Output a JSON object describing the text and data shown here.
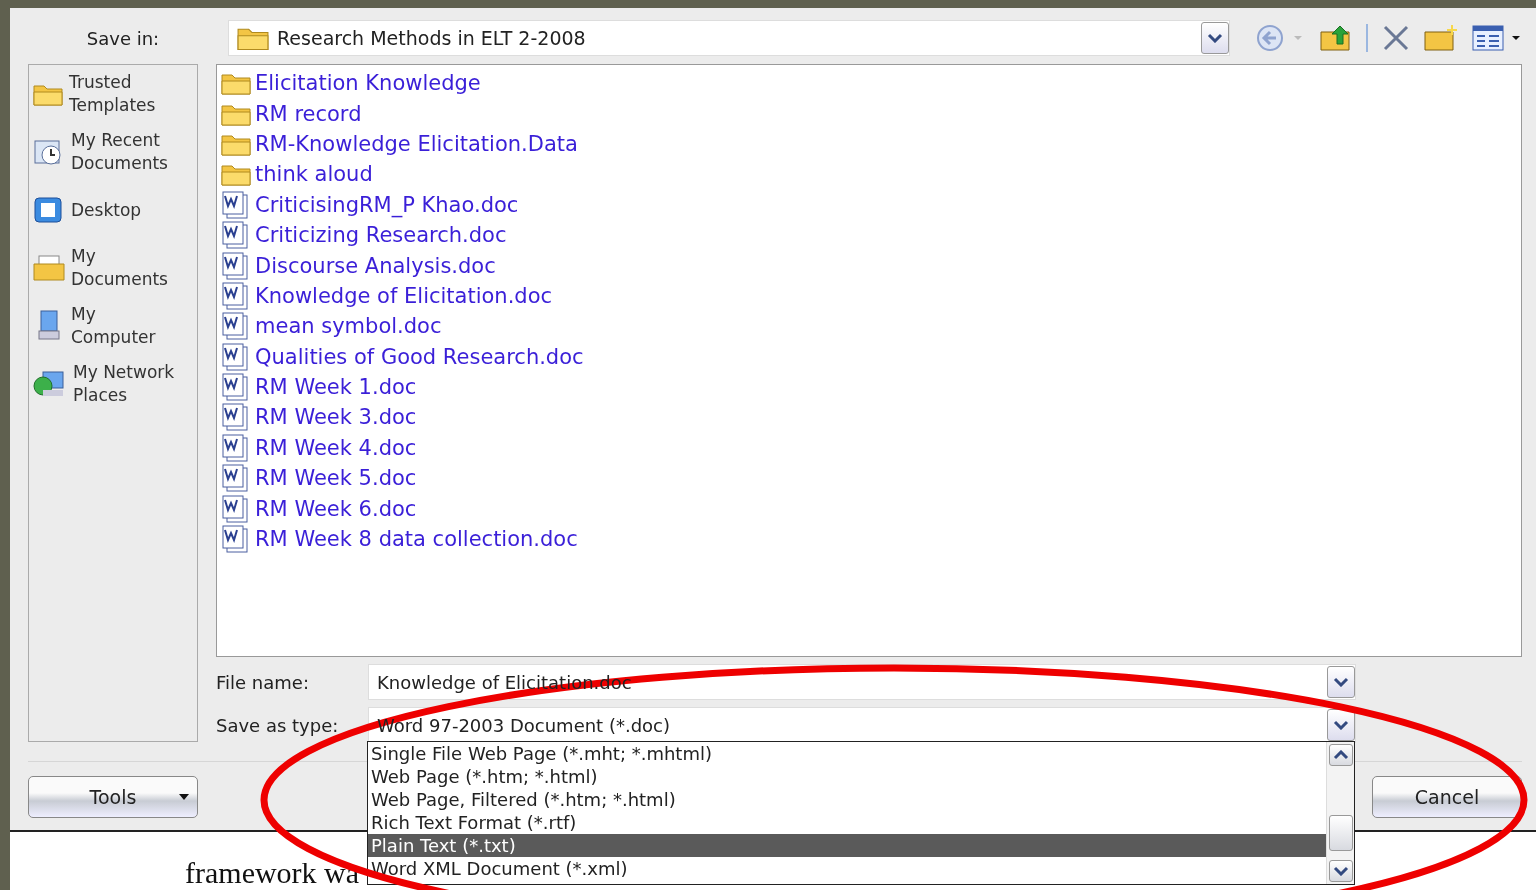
{
  "dialog": {
    "save_in_label": "Save in:",
    "save_in_value": "Research Methods in ELT 2-2008",
    "places": [
      {
        "kind": "folder",
        "label": "Trusted Templates"
      },
      {
        "kind": "recent",
        "label": "My Recent Documents"
      },
      {
        "kind": "desktop",
        "label": "Desktop"
      },
      {
        "kind": "documents",
        "label": "My Documents"
      },
      {
        "kind": "computer",
        "label": "My Computer"
      },
      {
        "kind": "network",
        "label": "My Network Places"
      }
    ],
    "files": [
      {
        "kind": "folder",
        "name": "Elicitation Knowledge"
      },
      {
        "kind": "folder",
        "name": "RM record"
      },
      {
        "kind": "folder",
        "name": "RM-Knowledge Elicitation.Data"
      },
      {
        "kind": "folder",
        "name": "think aloud"
      },
      {
        "kind": "doc",
        "name": "CriticisingRM_P Khao.doc"
      },
      {
        "kind": "doc",
        "name": "Criticizing Research.doc"
      },
      {
        "kind": "doc",
        "name": "Discourse Analysis.doc"
      },
      {
        "kind": "doc",
        "name": "Knowledge of Elicitation.doc"
      },
      {
        "kind": "doc",
        "name": "mean symbol.doc"
      },
      {
        "kind": "doc",
        "name": "Qualities of Good Research.doc"
      },
      {
        "kind": "doc",
        "name": "RM Week 1.doc"
      },
      {
        "kind": "doc",
        "name": "RM Week 3.doc"
      },
      {
        "kind": "doc",
        "name": "RM Week 4.doc"
      },
      {
        "kind": "doc",
        "name": "RM Week 5.doc"
      },
      {
        "kind": "doc",
        "name": "RM Week 6.doc"
      },
      {
        "kind": "doc",
        "name": "RM Week 8 data collection.doc"
      }
    ],
    "file_name_label": "File name:",
    "file_name_value": "Knowledge of Elicitation.doc",
    "save_type_label": "Save as type:",
    "save_type_value": "Word 97-2003 Document (*.doc)",
    "type_options": [
      {
        "label": "Single File Web Page (*.mht; *.mhtml)",
        "selected": false
      },
      {
        "label": "Web Page (*.htm; *.html)",
        "selected": false
      },
      {
        "label": "Web Page, Filtered (*.htm; *.html)",
        "selected": false
      },
      {
        "label": "Rich Text Format (*.rtf)",
        "selected": false
      },
      {
        "label": "Plain Text (*.txt)",
        "selected": true
      },
      {
        "label": "Word XML Document (*.xml)",
        "selected": false
      }
    ],
    "tools_button": "Tools",
    "cancel_button": "Cancel"
  },
  "document": {
    "lines": [
      {
        "left": "framework wa"
      }
    ]
  }
}
